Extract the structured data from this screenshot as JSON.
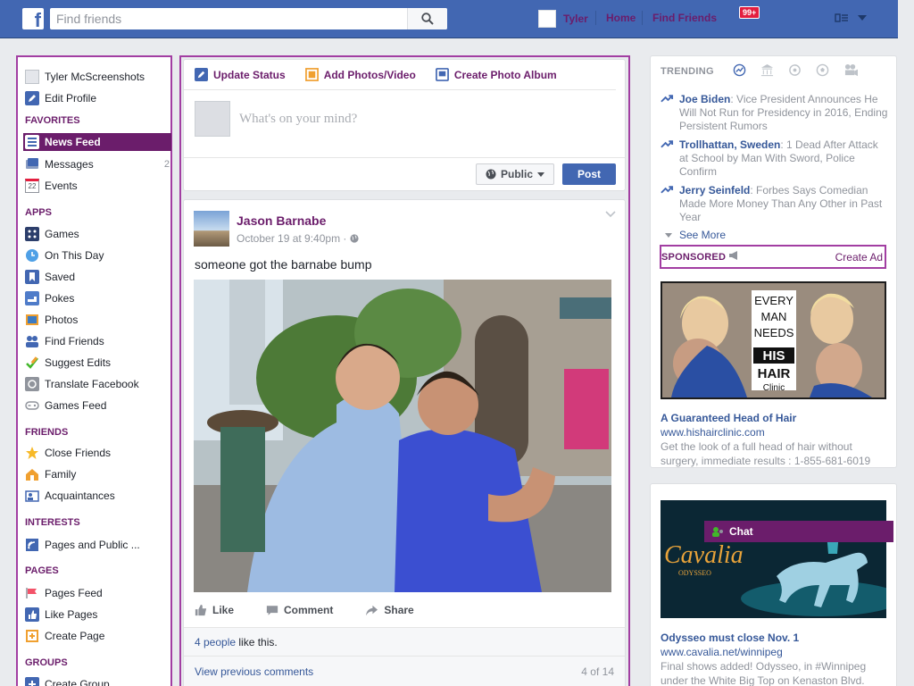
{
  "header": {
    "search_placeholder": "Find friends",
    "user_name": "Tyler",
    "home": "Home",
    "find_friends": "Find Friends",
    "notifications": "99+"
  },
  "sidebar": {
    "profile_name": "Tyler McScreenshots",
    "edit_profile": "Edit Profile",
    "favorites_heading": "FAVORITES",
    "favorites": [
      {
        "label": "News Feed",
        "icon": "news-feed-icon"
      },
      {
        "label": "Messages",
        "icon": "messages-icon",
        "count": "2"
      },
      {
        "label": "Events",
        "icon": "events-icon",
        "date": "22"
      }
    ],
    "apps_heading": "APPS",
    "apps": [
      {
        "label": "Games",
        "icon": "games-icon"
      },
      {
        "label": "On This Day",
        "icon": "on-this-day-icon"
      },
      {
        "label": "Saved",
        "icon": "saved-icon"
      },
      {
        "label": "Pokes",
        "icon": "pokes-icon"
      },
      {
        "label": "Photos",
        "icon": "photos-icon"
      },
      {
        "label": "Find Friends",
        "icon": "find-friends-icon"
      },
      {
        "label": "Suggest Edits",
        "icon": "suggest-edits-icon"
      },
      {
        "label": "Translate Facebook",
        "icon": "translate-icon"
      },
      {
        "label": "Games Feed",
        "icon": "games-feed-icon"
      }
    ],
    "friends_heading": "FRIENDS",
    "friends": [
      {
        "label": "Close Friends",
        "icon": "close-friends-icon"
      },
      {
        "label": "Family",
        "icon": "family-icon"
      },
      {
        "label": "Acquaintances",
        "icon": "acquaintances-icon"
      }
    ],
    "interests_heading": "INTERESTS",
    "interests": [
      {
        "label": "Pages and Public ...",
        "icon": "pages-public-icon"
      }
    ],
    "pages_heading": "PAGES",
    "pages": [
      {
        "label": "Pages Feed",
        "icon": "pages-feed-icon"
      },
      {
        "label": "Like Pages",
        "icon": "like-pages-icon"
      },
      {
        "label": "Create Page",
        "icon": "create-page-icon"
      }
    ],
    "groups_heading": "GROUPS",
    "groups": [
      {
        "label": "Create Group",
        "icon": "create-group-icon"
      }
    ]
  },
  "composer": {
    "tab_status": "Update Status",
    "tab_photos": "Add Photos/Video",
    "tab_album": "Create Photo Album",
    "placeholder": "What's on your mind?",
    "audience": "Public",
    "post": "Post"
  },
  "post": {
    "author": "Jason Barnabe",
    "time": "October 19 at 9:40pm · ",
    "text": "someone got the barnabe bump",
    "like": "Like",
    "comment": "Comment",
    "share": "Share",
    "likes_link": "4 people",
    "likes_rest": " like this.",
    "view_comments": "View previous comments",
    "comment_count": "4 of 14"
  },
  "trending": {
    "heading": "TRENDING",
    "items": [
      {
        "name": "Joe Biden",
        "text": ": Vice President Announces He Will Not Run for Presidency in 2016, Ending Persistent Rumors"
      },
      {
        "name": "Trollhattan, Sweden",
        "text": ": 1 Dead After Attack at School by Man With Sword, Police Confirm"
      },
      {
        "name": "Jerry Seinfeld",
        "text": ": Forbes Says Comedian Made More Money Than Any Other in Past Year"
      }
    ],
    "see_more": "See More"
  },
  "sponsored": {
    "label": "SPONSORED",
    "create_ad": "Create Ad",
    "ad1": {
      "img_line1": "EVERY",
      "img_line2": "MAN",
      "img_line3": "NEEDS",
      "img_logo1": "HIS",
      "img_logo2": "HAIR",
      "img_logo3": "Clinic",
      "title": "A Guaranteed Head of Hair",
      "url": "www.hishairclinic.com",
      "desc": "Get the look of a full head of hair without surgery, immediate results : 1-855-681-6019"
    },
    "ad2": {
      "img_word": "Cavalia",
      "img_sub": "ODYSSEO",
      "title": "Odysseo must close Nov. 1",
      "url": "www.cavalia.net/winnipeg",
      "desc": "Final shows added! Odysseo, in #Winnipeg under the White Big Top on Kenaston Blvd."
    }
  },
  "chat": {
    "label": "Chat"
  },
  "colors": {
    "brand": "#4267b2",
    "accent": "#6b1d6b",
    "highlight_border": "#a23ea2"
  }
}
